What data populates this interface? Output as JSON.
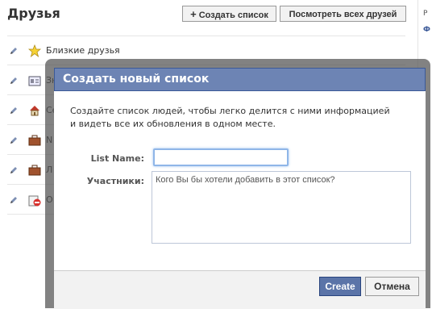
{
  "page": {
    "title": "Друзья",
    "create_list_label": "Создать список",
    "see_friends_label": "Посмотреть всех друзей",
    "right_fragments": [
      "Р",
      "Ф"
    ]
  },
  "lists": [
    {
      "label": "Близкие друзья",
      "icon": "star-icon"
    },
    {
      "label": "Зн",
      "icon": "id-card-icon"
    },
    {
      "label": "Се",
      "icon": "house-icon"
    },
    {
      "label": "N",
      "icon": "briefcase-icon"
    },
    {
      "label": "Л",
      "icon": "briefcase-icon"
    },
    {
      "label": "О",
      "icon": "restricted-icon"
    }
  ],
  "dialog": {
    "title": "Создать новый список",
    "description": "Создайте список людей, чтобы легко делится с ними информацией и видеть все их обновления в одном месте.",
    "name_label": "List Name:",
    "name_value": "",
    "members_label": "Участники:",
    "members_placeholder": "Кого Вы бы хотели добавить в этот список?",
    "create_label": "Create",
    "cancel_label": "Отмена"
  },
  "colors": {
    "header_bg": "#6d84b4",
    "header_border": "#3b5998",
    "primary_button": "#5b74a8"
  }
}
